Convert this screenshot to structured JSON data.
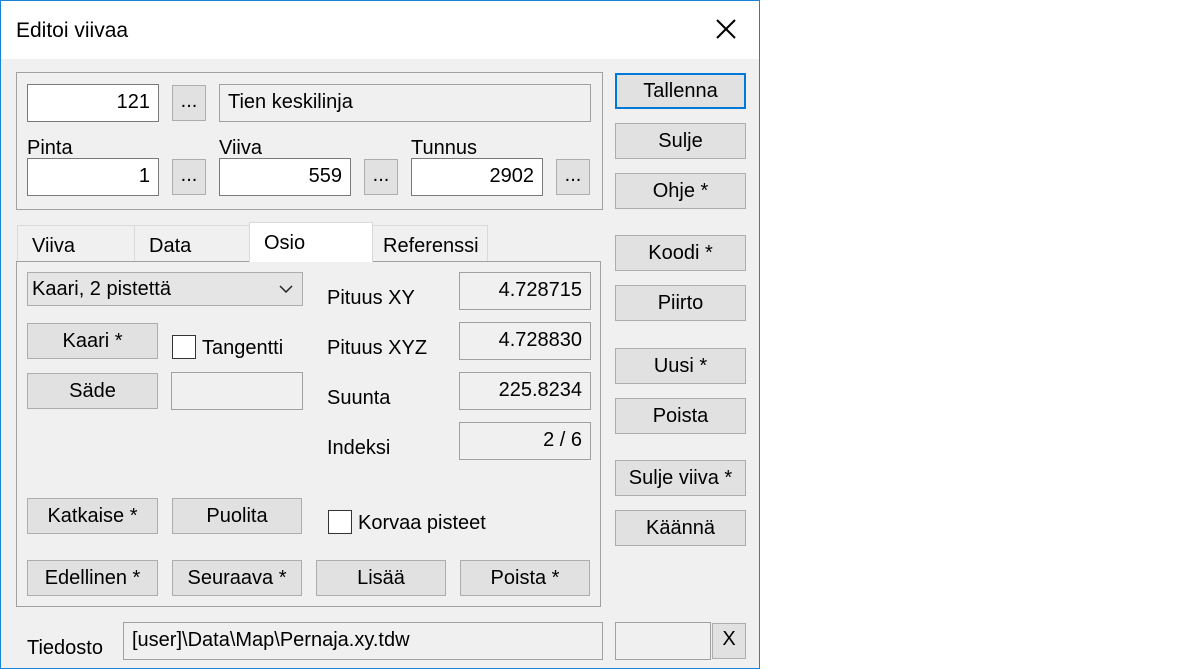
{
  "window": {
    "title": "Editoi viivaa"
  },
  "top": {
    "code_value": "121",
    "code_browse": "...",
    "code_name": "Tien keskilinja",
    "pinta_label": "Pinta",
    "pinta_value": "1",
    "pinta_browse": "...",
    "viiva_label": "Viiva",
    "viiva_value": "559",
    "viiva_browse": "...",
    "tunnus_label": "Tunnus",
    "tunnus_value": "2902",
    "tunnus_browse": "..."
  },
  "tabs": [
    {
      "label": "Viiva"
    },
    {
      "label": "Data"
    },
    {
      "label": "Osio"
    },
    {
      "label": "Referenssi"
    }
  ],
  "osio": {
    "type_selected": "Kaari, 2 pistettä",
    "kaari_button": "Kaari *",
    "tangentti_label": "Tangentti",
    "tangentti_checked": false,
    "sade_button": "Säde",
    "sade_value": "",
    "pituus_xy_label": "Pituus XY",
    "pituus_xy_value": "4.728715",
    "pituus_xyz_label": "Pituus XYZ",
    "pituus_xyz_value": "4.728830",
    "suunta_label": "Suunta",
    "suunta_value": "225.8234",
    "indeksi_label": "Indeksi",
    "indeksi_value": "2 / 6",
    "katkaise_button": "Katkaise *",
    "puolita_button": "Puolita",
    "korvaa_label": "Korvaa pisteet",
    "korvaa_checked": false,
    "edellinen_button": "Edellinen *",
    "seuraava_button": "Seuraava *",
    "lisaa_button": "Lisää",
    "poista_button": "Poista *"
  },
  "side": {
    "tallenna": "Tallenna",
    "sulje": "Sulje",
    "ohje": "Ohje *",
    "koodi": "Koodi *",
    "piirto": "Piirto",
    "uusi": "Uusi *",
    "poista": "Poista",
    "sulje_viiva": "Sulje viiva *",
    "kaanna": "Käännä"
  },
  "footer": {
    "tiedosto_label": "Tiedosto",
    "tiedosto_value": "[user]\\Data\\Map\\Pernaja.xy.tdw",
    "extra_value": "",
    "clear_button": "X"
  },
  "colors": {
    "accent": "#0078d7",
    "window_border": "#1883d7",
    "face": "#f0f0f0"
  }
}
